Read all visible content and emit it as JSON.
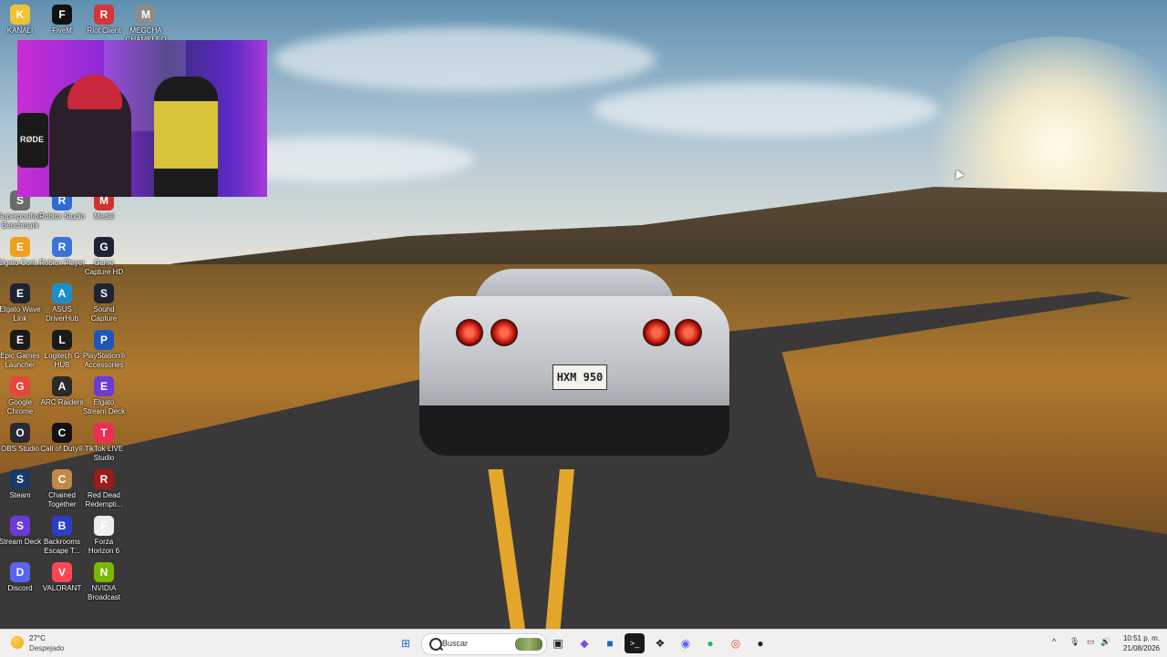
{
  "desktop": {
    "icons": [
      {
        "label": "KANALI",
        "icon": "folder-icon",
        "color": "#f1c232"
      },
      {
        "label": "FiveM",
        "icon": "fivem-icon",
        "color": "#111111"
      },
      {
        "label": "Riot Client",
        "icon": "riot-icon",
        "color": "#d13639"
      },
      {
        "label": "MEGCHA CHAMELEON",
        "icon": "app-icon",
        "color": "#8c8c8c"
      },
      {
        "label": "Superposition Benchmark",
        "icon": "benchmark-icon",
        "color": "#6a6a6a"
      },
      {
        "label": "Roblox Studio",
        "icon": "roblox-studio-icon",
        "color": "#2b6cd6"
      },
      {
        "label": "Medal",
        "icon": "medal-icon",
        "color": "#d33030"
      },
      {
        "label": "Elgato Cont...",
        "icon": "elgato-control-icon",
        "color": "#f0a020"
      },
      {
        "label": "Roblox Player",
        "icon": "roblox-icon",
        "color": "#3b74d9"
      },
      {
        "label": "Game Capture HD",
        "icon": "game-capture-icon",
        "color": "#1d2333"
      },
      {
        "label": "Elgato Wave Link",
        "icon": "wave-link-icon",
        "color": "#1d2333"
      },
      {
        "label": "ASUS DriverHub",
        "icon": "asus-icon",
        "color": "#1a8fc9"
      },
      {
        "label": "Sound Capture",
        "icon": "sound-capture-icon",
        "color": "#1d2333"
      },
      {
        "label": "Epic Games Launcher",
        "icon": "epic-icon",
        "color": "#1a1a1a"
      },
      {
        "label": "Logitech G HUB",
        "icon": "logitech-icon",
        "color": "#1a1a1a"
      },
      {
        "label": "PlayStation® Accessories",
        "icon": "playstation-icon",
        "color": "#1e56b8"
      },
      {
        "label": "Google Chrome",
        "icon": "chrome-icon",
        "color": "#e8453c"
      },
      {
        "label": "ARC Raiders",
        "icon": "arc-raiders-icon",
        "color": "#2a2a2a"
      },
      {
        "label": "Elgato Stream Deck",
        "icon": "stream-deck-icon",
        "color": "#6b3bd6"
      },
      {
        "label": "OBS Studio",
        "icon": "obs-icon",
        "color": "#2a2a33"
      },
      {
        "label": "Call of Duty®",
        "icon": "cod-icon",
        "color": "#111111"
      },
      {
        "label": "TikTok LIVE Studio",
        "icon": "tiktok-icon",
        "color": "#ee2d55"
      },
      {
        "label": "Steam",
        "icon": "steam-icon",
        "color": "#173a66"
      },
      {
        "label": "Chained Together",
        "icon": "chained-icon",
        "color": "#c28a4a"
      },
      {
        "label": "Red Dead Redempti...",
        "icon": "rdr-icon",
        "color": "#9a1b1b"
      },
      {
        "label": "Stream Deck",
        "icon": "stream-deck-icon",
        "color": "#6b3bd6"
      },
      {
        "label": "Backrooms Escape T...",
        "icon": "backrooms-icon",
        "color": "#2a3fc4"
      },
      {
        "label": "Forza Horizon 6",
        "icon": "forza-icon",
        "color": "#eeeeee"
      },
      {
        "label": "Discord",
        "icon": "discord-icon",
        "color": "#5865f2"
      },
      {
        "label": "VALORANT",
        "icon": "valorant-icon",
        "color": "#ff4655"
      },
      {
        "label": "NVIDIA Broadcast",
        "icon": "nvidia-icon",
        "color": "#76b900"
      }
    ]
  },
  "wallpaper": {
    "plate": "HXM 950"
  },
  "webcam": {
    "mic_brand": "RØDE"
  },
  "taskbar": {
    "weather": {
      "temp": "27°C",
      "condition": "Despejado"
    },
    "search_placeholder": "Buscar",
    "apps": [
      {
        "name": "start",
        "glyph": "⊞"
      },
      {
        "name": "task-view",
        "glyph": "▣"
      },
      {
        "name": "copilot",
        "glyph": "◆"
      },
      {
        "name": "store",
        "glyph": "■"
      },
      {
        "name": "terminal",
        "glyph": ">_"
      },
      {
        "name": "app",
        "glyph": "❖"
      },
      {
        "name": "discord",
        "glyph": "◉"
      },
      {
        "name": "spotify",
        "glyph": "●"
      },
      {
        "name": "chrome",
        "glyph": "◎"
      },
      {
        "name": "obs",
        "glyph": "●"
      }
    ],
    "tray": {
      "chevron": "^",
      "mic": "🎙",
      "display": "▭",
      "volume": "🔊"
    },
    "clock": {
      "time": "10:51 p. m.",
      "date": "21/08/2026"
    }
  }
}
